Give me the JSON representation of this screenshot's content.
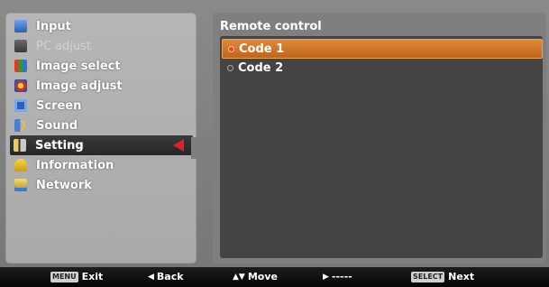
{
  "menu": {
    "items": [
      {
        "label": "Input",
        "icon": "input-icon",
        "color": "#3c7bd9",
        "state": "normal"
      },
      {
        "label": "PC adjust",
        "icon": "pc-adjust-icon",
        "color": "#555555",
        "state": "disabled"
      },
      {
        "label": "Image select",
        "icon": "image-select-icon",
        "color": "#2a9a3a",
        "state": "normal"
      },
      {
        "label": "Image adjust",
        "icon": "image-adjust-icon",
        "color": "#d23a2a",
        "state": "normal"
      },
      {
        "label": "Screen",
        "icon": "screen-icon",
        "color": "#3a6fc8",
        "state": "normal"
      },
      {
        "label": "Sound",
        "icon": "sound-icon",
        "color": "#6aa0e0",
        "state": "normal"
      },
      {
        "label": "Setting",
        "icon": "setting-icon",
        "color": "#e0c040",
        "state": "selected"
      },
      {
        "label": "Information",
        "icon": "information-icon",
        "color": "#e8c020",
        "state": "normal"
      },
      {
        "label": "Network",
        "icon": "network-icon",
        "color": "#d8b030",
        "state": "normal"
      }
    ],
    "selection_arrow": "red-left-arrow-icon"
  },
  "panel": {
    "title": "Remote control",
    "options": [
      {
        "label": "Code 1",
        "selected": true
      },
      {
        "label": "Code 2",
        "selected": false
      }
    ]
  },
  "footer": {
    "exit_key": "MENU",
    "exit": "Exit",
    "back_glyph": "◀",
    "back": "Back",
    "move_glyph": "▲▼",
    "move": "Move",
    "right_glyph": "▶",
    "right": "-----",
    "next_key": "SELECT",
    "next": "Next"
  },
  "colors": {
    "accent": "#d47a2c",
    "selected_menu_bg": "#2e2e2e",
    "arrow": "#e0202a"
  }
}
